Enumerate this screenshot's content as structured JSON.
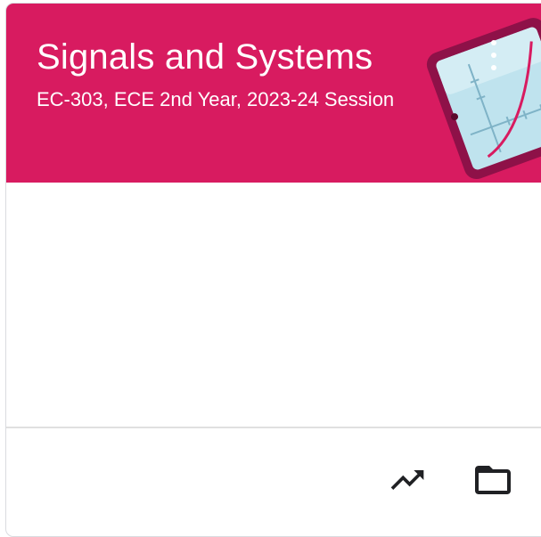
{
  "course": {
    "title": "Signals and Systems",
    "subtitle": "EC-303, ECE 2nd Year, 2023-24 Session"
  },
  "header": {
    "background_color": "#d81b60",
    "illustration_icon": "tablet-graph-illustration"
  },
  "actions": {
    "more_icon": "more-vertical-icon",
    "grades_icon": "trending-up-icon",
    "folder_icon": "folder-icon"
  },
  "colors": {
    "icon": "#202124",
    "divider": "#e0e0e0",
    "border": "#dadce0"
  }
}
